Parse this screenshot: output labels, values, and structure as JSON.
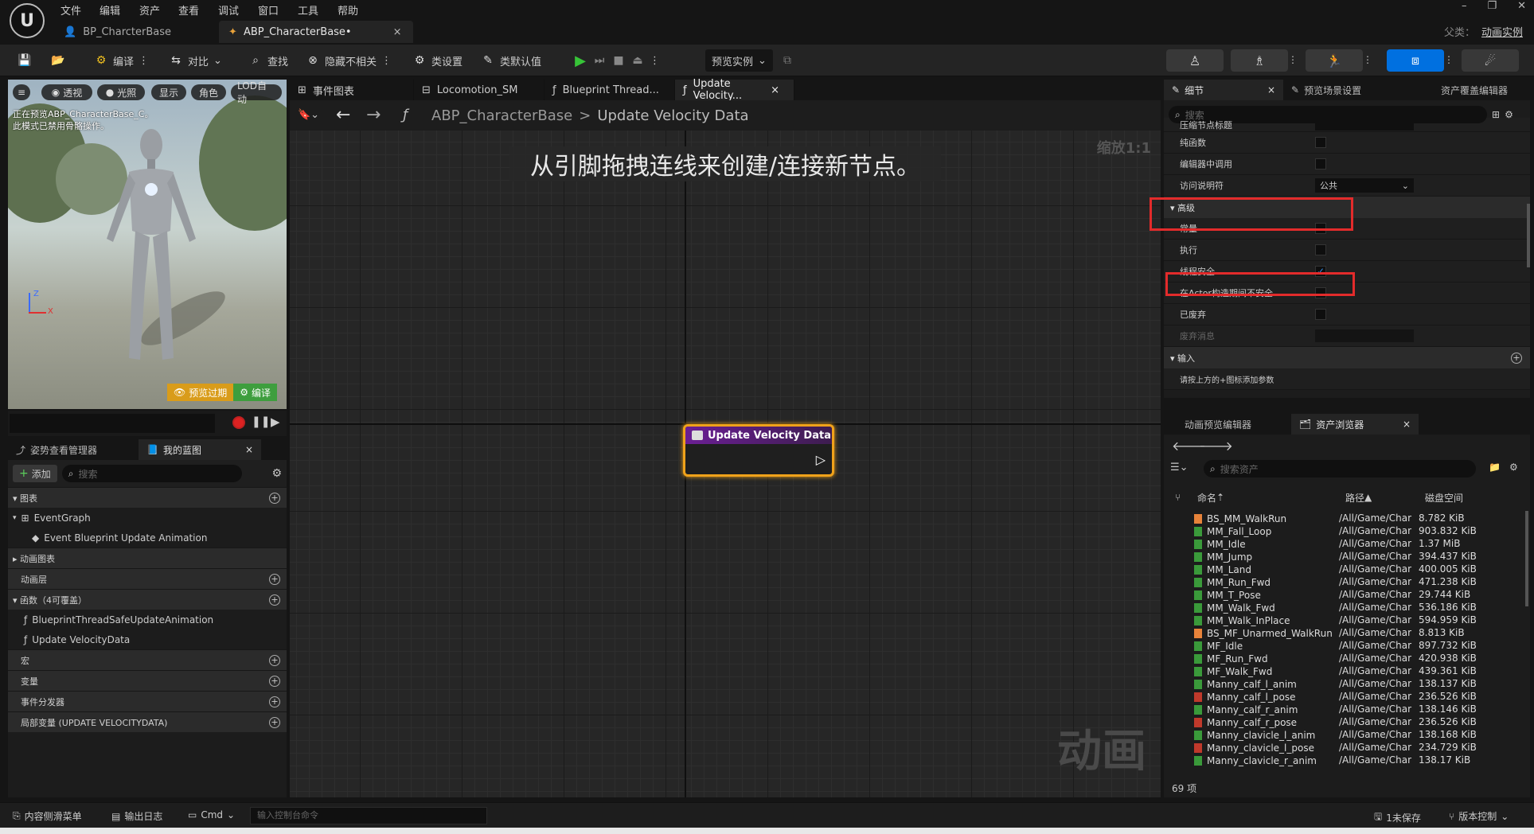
{
  "menu": [
    "文件",
    "编辑",
    "资产",
    "查看",
    "调试",
    "窗口",
    "工具",
    "帮助"
  ],
  "logo": "U",
  "window_controls": [
    "–",
    "❐",
    "✕"
  ],
  "doc_tabs": [
    {
      "label": "BP_CharcterBase"
    },
    {
      "label": "ABP_CharacterBase•"
    }
  ],
  "doc_tab_close": "×",
  "parent_class": {
    "label": "父类：",
    "value": "动画实例"
  },
  "toolbar": {
    "compile": "编译",
    "diff": "对比",
    "find": "查找",
    "hide_unrelated": "隐藏不相关",
    "class_settings": "类设置",
    "class_defaults": "类默认值",
    "preview_instance": "预览实例"
  },
  "viewport": {
    "buttons": [
      "≡",
      "透视",
      "光照",
      "显示",
      "角色",
      "LOD自动"
    ],
    "message_line1": "正在预览ABP_CharacterBase_C。",
    "message_line2": "此模式已禁用骨骼操作。",
    "preview_expired": "预览过期",
    "compile": "编译",
    "axis_z": "Z",
    "axis_x": "X"
  },
  "left_panel": {
    "tabs": [
      "姿势查看管理器",
      "我的蓝图"
    ],
    "add": "添加",
    "search_placeholder": "搜索",
    "sections": {
      "graphs": "图表",
      "event_graph": "EventGraph",
      "event_bp_update": "Event Blueprint Update Animation",
      "anim_graphs": "动画图表",
      "anim_layers": "动画层",
      "functions": "函数（4可覆盖）",
      "func1": "BlueprintThreadSafeUpdateAnimation",
      "func2": "Update VelocityData",
      "macros": "宏",
      "variables": "变量",
      "event_dispatchers": "事件分发器",
      "local_vars": "局部变量 (UPDATE VELOCITYDATA)"
    }
  },
  "graph_tabs": [
    "事件图表",
    "Locomotion_SM",
    "Blueprint Thread...",
    "Update Velocity..."
  ],
  "breadcrumb": {
    "root": "ABP_CharacterBase",
    "current": "Update Velocity Data",
    "separator": ">"
  },
  "zoom": "缩放1:1",
  "graph_hint": "从引脚拖拽连线来创建/连接新节点。",
  "node_title": "Update Velocity Data",
  "watermark": "动画",
  "details": {
    "tabs": [
      "细节",
      "预览场景设置",
      "资产覆盖编辑器"
    ],
    "search_placeholder": "搜索",
    "rows": [
      {
        "label": "压缩节点标题"
      },
      {
        "label": "纯函数",
        "checked": false
      },
      {
        "label": "编辑器中调用",
        "checked": false
      },
      {
        "label": "访问说明符",
        "value": "公共"
      }
    ],
    "section_advanced": "高级",
    "adv_rows": [
      {
        "label": "常量",
        "checked": false
      },
      {
        "label": "执行",
        "checked": false
      },
      {
        "label": "线程安全",
        "checked": true
      },
      {
        "label": "在Actor构造期间不安全",
        "checked": false
      },
      {
        "label": "已废弃",
        "checked": false
      },
      {
        "label": "废弃消息"
      }
    ],
    "section_inputs": "输入",
    "inputs_hint": "请按上方的+图标添加参数"
  },
  "asset_browser": {
    "tabs": [
      "动画预览编辑器",
      "资产浏览器"
    ],
    "search_placeholder": "搜索资产",
    "columns": [
      "命名",
      "路径",
      "磁盘空间"
    ],
    "count": "69 项",
    "rows": [
      {
        "name": "BS_MM_WalkRun",
        "path": "/All/Game/Char",
        "size": "8.782 KiB",
        "kind": "blendspace"
      },
      {
        "name": "MM_Fall_Loop",
        "path": "/All/Game/Char",
        "size": "903.832 KiB",
        "kind": "anim"
      },
      {
        "name": "MM_Idle",
        "path": "/All/Game/Char",
        "size": "1.37 MiB",
        "kind": "anim"
      },
      {
        "name": "MM_Jump",
        "path": "/All/Game/Char",
        "size": "394.437 KiB",
        "kind": "anim"
      },
      {
        "name": "MM_Land",
        "path": "/All/Game/Char",
        "size": "400.005 KiB",
        "kind": "anim"
      },
      {
        "name": "MM_Run_Fwd",
        "path": "/All/Game/Char",
        "size": "471.238 KiB",
        "kind": "anim"
      },
      {
        "name": "MM_T_Pose",
        "path": "/All/Game/Char",
        "size": "29.744 KiB",
        "kind": "anim"
      },
      {
        "name": "MM_Walk_Fwd",
        "path": "/All/Game/Char",
        "size": "536.186 KiB",
        "kind": "anim"
      },
      {
        "name": "MM_Walk_InPlace",
        "path": "/All/Game/Char",
        "size": "594.959 KiB",
        "kind": "anim"
      },
      {
        "name": "BS_MF_Unarmed_WalkRun",
        "path": "/All/Game/Char",
        "size": "8.813 KiB",
        "kind": "blendspace"
      },
      {
        "name": "MF_Idle",
        "path": "/All/Game/Char",
        "size": "897.732 KiB",
        "kind": "anim"
      },
      {
        "name": "MF_Run_Fwd",
        "path": "/All/Game/Char",
        "size": "420.938 KiB",
        "kind": "anim"
      },
      {
        "name": "MF_Walk_Fwd",
        "path": "/All/Game/Char",
        "size": "439.361 KiB",
        "kind": "anim"
      },
      {
        "name": "Manny_calf_l_anim",
        "path": "/All/Game/Char",
        "size": "138.137 KiB",
        "kind": "anim"
      },
      {
        "name": "Manny_calf_l_pose",
        "path": "/All/Game/Char",
        "size": "236.526 KiB",
        "kind": "pose"
      },
      {
        "name": "Manny_calf_r_anim",
        "path": "/All/Game/Char",
        "size": "138.146 KiB",
        "kind": "anim"
      },
      {
        "name": "Manny_calf_r_pose",
        "path": "/All/Game/Char",
        "size": "236.526 KiB",
        "kind": "pose"
      },
      {
        "name": "Manny_clavicle_l_anim",
        "path": "/All/Game/Char",
        "size": "138.168 KiB",
        "kind": "anim"
      },
      {
        "name": "Manny_clavicle_l_pose",
        "path": "/All/Game/Char",
        "size": "234.729 KiB",
        "kind": "pose"
      },
      {
        "name": "Manny_clavicle_r_anim",
        "path": "/All/Game/Char",
        "size": "138.17 KiB",
        "kind": "anim"
      }
    ]
  },
  "statusbar": {
    "drawer": "内容侧滑菜单",
    "output_log": "输出日志",
    "cmd": "Cmd",
    "cmd_placeholder": "输入控制台命令",
    "unsaved": "1未保存",
    "source_control": "版本控制"
  },
  "colors": {
    "accent": "#0070e0",
    "node_border": "#f0a21a",
    "highlight": "#e32b2b",
    "play": "#37c438",
    "blendspace": "#e8833a",
    "anim": "#3a9a3a",
    "pose": "#c0392b"
  }
}
